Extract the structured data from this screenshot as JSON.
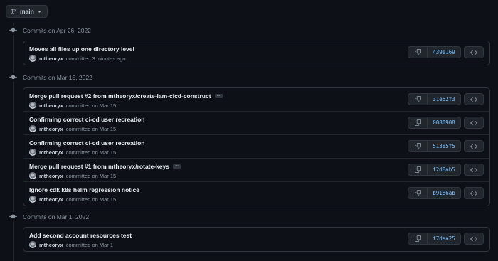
{
  "branch": {
    "name": "main",
    "icon": "git-branch-icon"
  },
  "groups": [
    {
      "date_label": "Commits on Apr 26, 2022",
      "commits": [
        {
          "message": "Moves all files up one directory level",
          "has_ellipsis": false,
          "author": "mtheoryx",
          "committed_text": "committed 3 minutes ago",
          "sha": "439e169"
        }
      ]
    },
    {
      "date_label": "Commits on Mar 15, 2022",
      "commits": [
        {
          "message": "Merge pull request #2 from mtheoryx/create-iam-cicd-construct",
          "has_ellipsis": true,
          "author": "mtheoryx",
          "committed_text": "committed on Mar 15",
          "sha": "31e52f3"
        },
        {
          "message": "Confirming correct ci-cd user recreation",
          "has_ellipsis": false,
          "author": "mtheoryx",
          "committed_text": "committed on Mar 15",
          "sha": "0080908"
        },
        {
          "message": "Confirming correct ci-cd user recreation",
          "has_ellipsis": false,
          "author": "mtheoryx",
          "committed_text": "committed on Mar 15",
          "sha": "51385f5"
        },
        {
          "message": "Merge pull request #1 from mtheoryx/rotate-keys",
          "has_ellipsis": true,
          "author": "mtheoryx",
          "committed_text": "committed on Mar 15",
          "sha": "f2d8ab5"
        },
        {
          "message": "Ignore cdk k8s helm regression notice",
          "has_ellipsis": false,
          "author": "mtheoryx",
          "committed_text": "committed on Mar 15",
          "sha": "b9186ab"
        }
      ]
    },
    {
      "date_label": "Commits on Mar 1, 2022",
      "commits": [
        {
          "message": "Add second account resources test",
          "has_ellipsis": false,
          "author": "mtheoryx",
          "committed_text": "committed on Mar 1",
          "sha": "f7daa25"
        }
      ]
    }
  ],
  "colors": {
    "background": "#0d1117",
    "border": "#30363d",
    "sha_link": "#79c0ff",
    "muted": "#8b949e"
  }
}
